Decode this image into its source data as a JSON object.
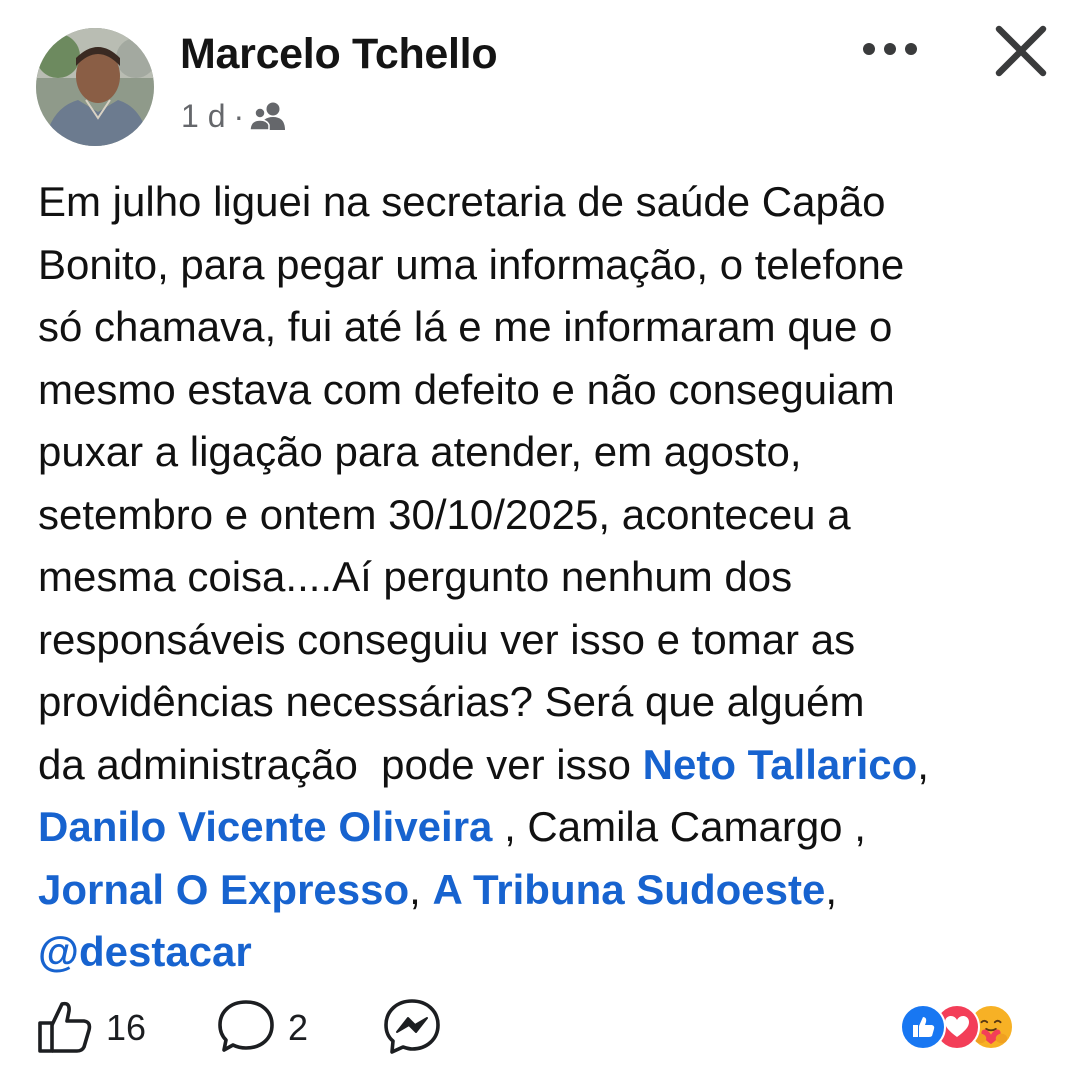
{
  "post": {
    "author": "Marcelo Tchello",
    "time": "1 d",
    "separator": "·",
    "audience_icon": "friends-icon",
    "text_lines": [
      "Em julho liguei na secretaria de saúde Capão",
      "Bonito,  para pegar uma informação,  o telefone",
      "só  chamava, fui até lá e me informaram  que o",
      "mesmo estava com defeito e não  conseguiam",
      "puxar a ligação  para atender, em agosto,",
      "setembro e ontem 30/10/2025, aconteceu  a",
      "mesma coisa....Aí pergunto nenhum dos",
      "responsáveis  conseguiu ver isso e tomar as",
      "providências  necessárias? Será  que alguém"
    ],
    "line10_text": "da administração  pode ver isso ",
    "mentions": {
      "neto": "Neto Tallarico",
      "danilo": "Danilo Vicente Oliveira",
      "jornal": "Jornal O Expresso",
      "tribuna": "A Tribuna Sudoeste",
      "destacar": "@destacar"
    },
    "plain_camila": " , Camila Camargo ,",
    "comma": ",",
    "comma_space": ", "
  },
  "actions": {
    "likes": "16",
    "comments": "2",
    "like_icon": "thumbs-up-icon",
    "comment_icon": "comment-bubble-icon",
    "share_icon": "messenger-icon"
  },
  "reactions": [
    "like",
    "love",
    "care"
  ],
  "colors": {
    "mention": "#1763cf",
    "like_blue": "#1877f2",
    "love_red": "#f33e58",
    "care_yellow": "#f7b125"
  }
}
